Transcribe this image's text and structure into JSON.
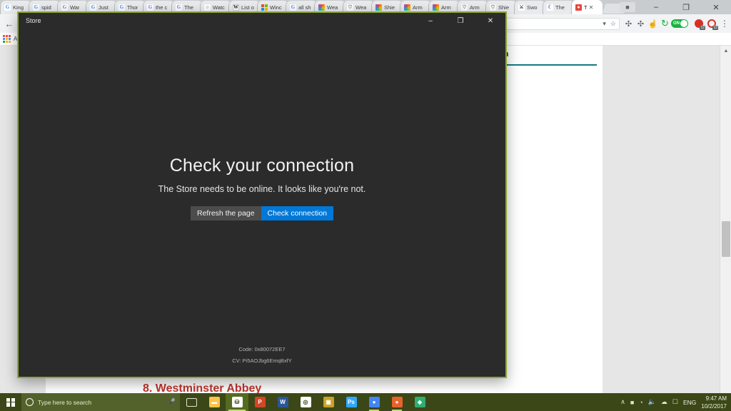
{
  "browser": {
    "tabs": [
      {
        "label": "King",
        "icon": "google-favicon",
        "active": false
      },
      {
        "label": "spid",
        "icon": "google-favicon",
        "active": false
      },
      {
        "label": "War",
        "icon": "google-favicon",
        "active": false
      },
      {
        "label": "Just",
        "icon": "google-favicon",
        "active": false
      },
      {
        "label": "Thor",
        "icon": "google-favicon",
        "active": false
      },
      {
        "label": "the c",
        "icon": "google-favicon",
        "active": false
      },
      {
        "label": "The",
        "icon": "google-favicon",
        "active": false
      },
      {
        "label": "Watc",
        "icon": "watch-favicon",
        "active": false
      },
      {
        "label": "List o",
        "icon": "wikipedia-favicon",
        "active": false
      },
      {
        "label": "Winc",
        "icon": "microsoft-favicon",
        "active": false
      },
      {
        "label": "all sh",
        "icon": "google-favicon",
        "active": false
      },
      {
        "label": "Wea",
        "icon": "rainbow-favicon",
        "active": false
      },
      {
        "label": "Wea",
        "icon": "heart-favicon",
        "active": false
      },
      {
        "label": "Shie",
        "icon": "rainbow-favicon",
        "active": false
      },
      {
        "label": "Arm",
        "icon": "rainbow-favicon",
        "active": false
      },
      {
        "label": "Arm",
        "icon": "rainbow-favicon",
        "active": false
      },
      {
        "label": "Arm",
        "icon": "heart-favicon",
        "active": false
      },
      {
        "label": "Shie",
        "icon": "heart-favicon",
        "active": false
      },
      {
        "label": "Swo",
        "icon": "sword-favicon",
        "active": false
      },
      {
        "label": "The",
        "icon": "moon-favicon",
        "active": false
      },
      {
        "label": "T",
        "icon": "red-favicon",
        "active": true
      }
    ],
    "window_controls": {
      "minimize": "–",
      "maximize": "❐",
      "close": "✕",
      "profile": "■"
    },
    "toolbar": {
      "back_icon": "back-arrow-icon",
      "omnibox_value": "",
      "omnibox_dropdown": "▾",
      "bookmark_star": "☆",
      "extension_1": "puzzle-piece-icon",
      "extension_2": "puzzle-piece-icon",
      "extension_3": "pointer-icon",
      "extension_4": "history-clock-icon",
      "toggle_label": "ON",
      "badge_1_count": "12",
      "badge_2_count": "12",
      "menu_icon": "⋮"
    },
    "bookmarks": {
      "apps_label": "A"
    },
    "page": {
      "section_title": "veller Information",
      "heading": "8. Westminster Abbey",
      "accent_color": "#147a82",
      "heading_color": "#c1342c"
    }
  },
  "store_window": {
    "title": "Store",
    "controls": {
      "minimize": "–",
      "maximize": "❐",
      "close": "✕"
    },
    "error": {
      "title": "Check your connection",
      "subtitle": "The Store needs to be online. It looks like you're not.",
      "refresh_button": "Refresh the page",
      "check_button": "Check connection",
      "code_line": "Code: 0x80072EE7",
      "cv_line": "CV: Pi5AOJbg6EmqBxfY"
    },
    "colors": {
      "background": "#2b2b2b",
      "border": "#8aa832",
      "primary_button": "#0078d7",
      "secondary_button": "#4c4c4c"
    }
  },
  "taskbar": {
    "start_icon": "windows-start-icon",
    "search_placeholder": "Type here to search",
    "mic_icon": "microphone-icon",
    "taskview_icon": "task-view-icon",
    "apps": [
      {
        "name": "file-explorer",
        "glyph": "▬",
        "color": "#ffc24a",
        "running": false
      },
      {
        "name": "microsoft-store",
        "glyph": "⛁",
        "color": "#ffffff",
        "running": true
      },
      {
        "name": "powerpoint",
        "glyph": "P",
        "color": "#d24726",
        "running": false
      },
      {
        "name": "word",
        "glyph": "W",
        "color": "#2b579a",
        "running": false
      },
      {
        "name": "spiral-app",
        "glyph": "◎",
        "color": "#ffffff",
        "running": false
      },
      {
        "name": "picture-app",
        "glyph": "▣",
        "color": "#c9a227",
        "running": false
      },
      {
        "name": "photoshop",
        "glyph": "Ps",
        "color": "#31a8ff",
        "running": false
      },
      {
        "name": "chrome",
        "glyph": "●",
        "color": "#4285f4",
        "running": true
      },
      {
        "name": "firefox-like-app",
        "glyph": "●",
        "color": "#e8622c",
        "running": true
      },
      {
        "name": "green-diamond-app",
        "glyph": "◆",
        "color": "#2fae72",
        "running": false
      }
    ],
    "tray": {
      "chevron": "∧",
      "battery": "battery-icon",
      "wifi": "wifi-icon",
      "volume": "speaker-icon",
      "onedrive": "onedrive-icon",
      "keyboard": "keyboard-icon",
      "language": "ENG",
      "time": "9:47 AM",
      "date": "10/2/2017"
    },
    "background_color": "#3b4716"
  }
}
